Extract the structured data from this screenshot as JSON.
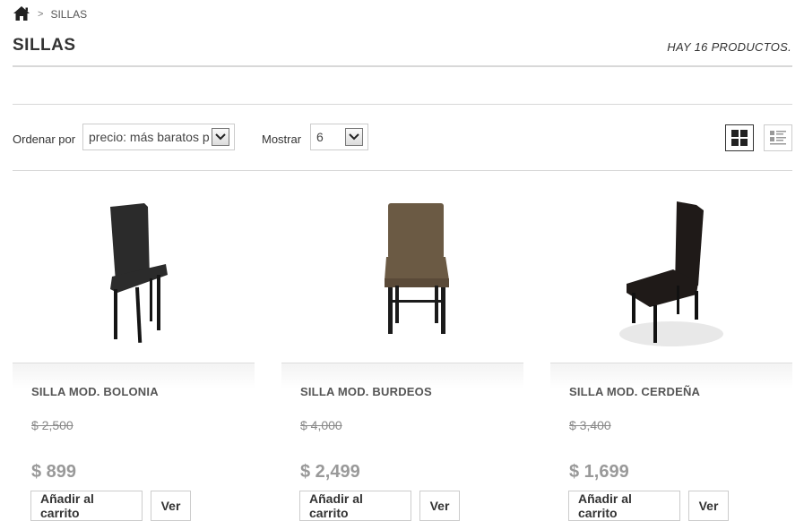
{
  "breadcrumb": {
    "separator": ">",
    "current": "SILLAS"
  },
  "page": {
    "title": "SILLAS",
    "count": "HAY 16 PRODUCTOS."
  },
  "sort": {
    "label": "Ordenar por",
    "value": "precio: más baratos p",
    "show_label": "Mostrar",
    "show_value": "6"
  },
  "view_modes": [
    "grid",
    "list"
  ],
  "products": [
    {
      "name": "SILLA MOD. BOLONIA",
      "old_price": "$ 2,500",
      "price": "$ 899",
      "cart_label": "Añadir al carrito",
      "view_label": "Ver",
      "upholstery_color": "#2b2b2b"
    },
    {
      "name": "SILLA MOD. BURDEOS",
      "old_price": "$ 4,000",
      "price": "$ 2,499",
      "cart_label": "Añadir al carrito",
      "view_label": "Ver",
      "upholstery_color": "#6b5a44"
    },
    {
      "name": "SILLA MOD. CERDEÑA",
      "old_price": "$ 3,400",
      "price": "$ 1,699",
      "cart_label": "Añadir al carrito",
      "view_label": "Ver",
      "upholstery_color": "#1f1a18"
    }
  ]
}
